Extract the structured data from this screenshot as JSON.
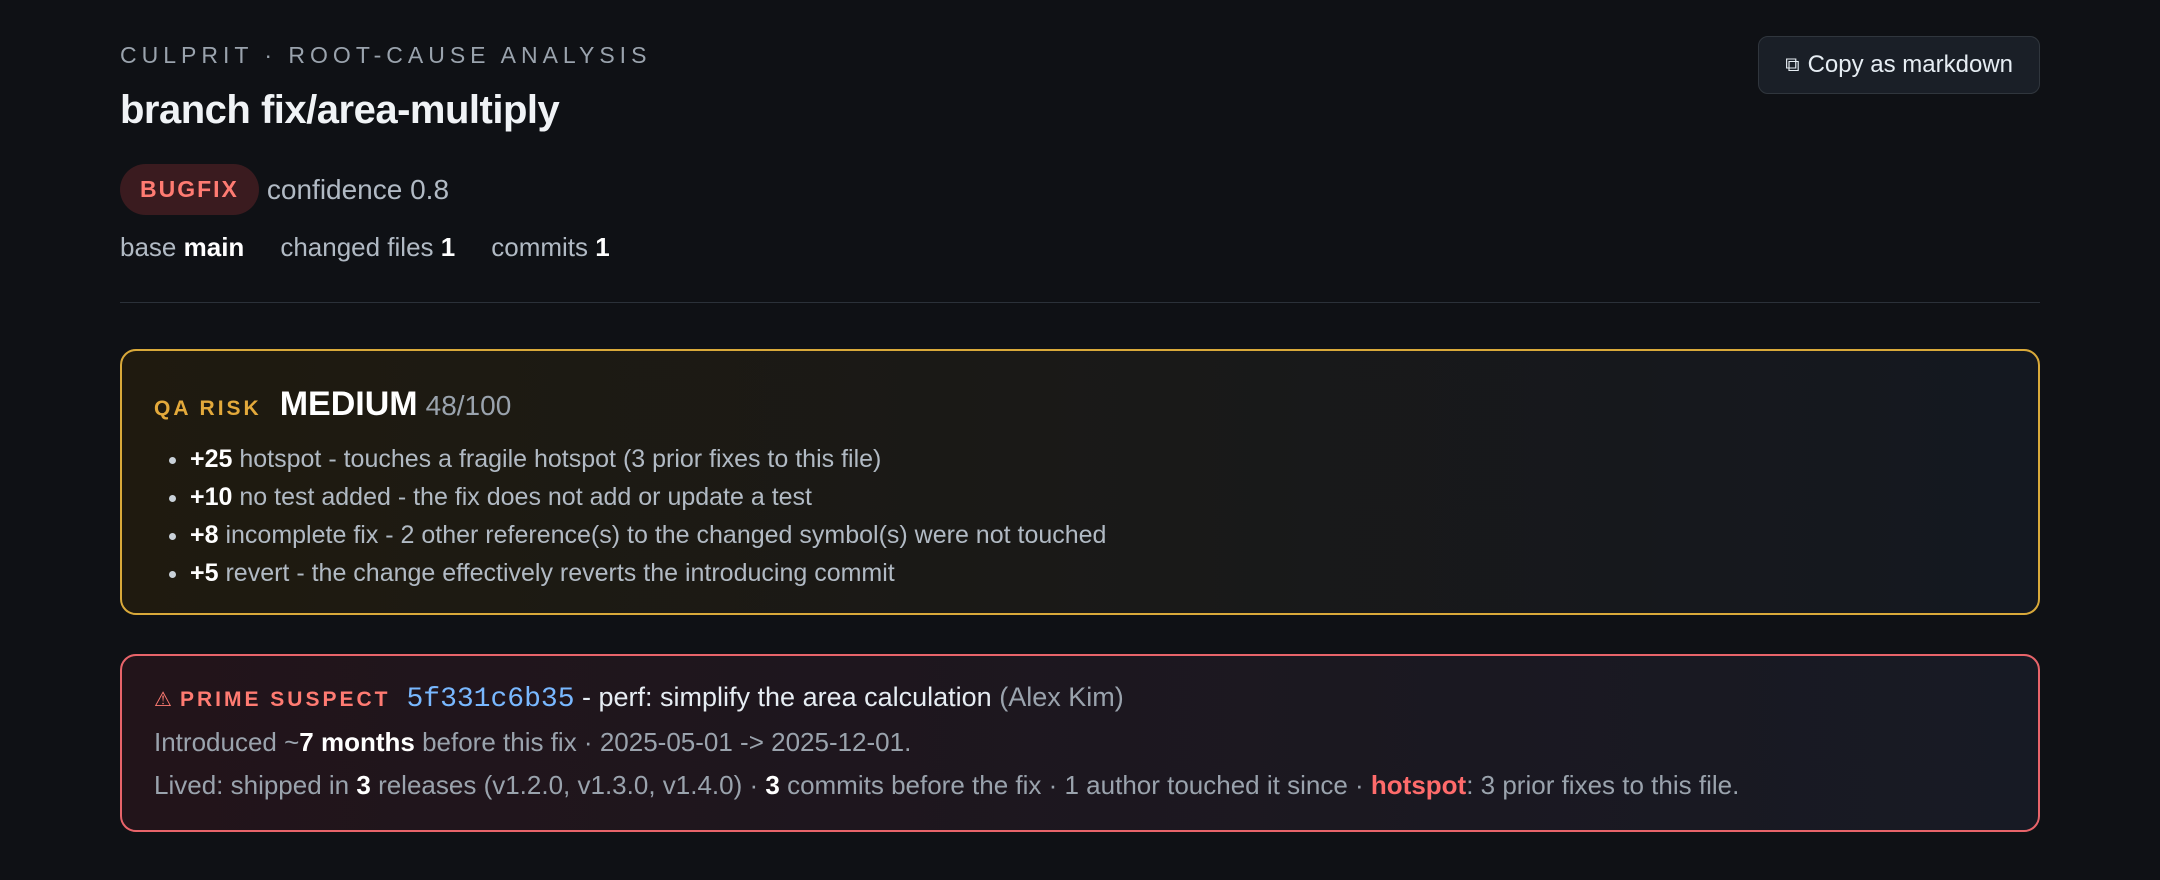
{
  "header": {
    "eyebrow": "CULPRIT · ROOT-CAUSE ANALYSIS",
    "title": "branch fix/area-multiply",
    "copy_label": "Copy as markdown",
    "copy_icon": "copy-icon"
  },
  "classification": {
    "badge": "BUGFIX",
    "confidence": "confidence 0.8",
    "badge_color": "#ff7b72"
  },
  "meta": {
    "base_label": "base",
    "base_value": "main",
    "files_label": "changed files",
    "files_value": "1",
    "commits_label": "commits",
    "commits_value": "1"
  },
  "qa_risk": {
    "label": "QA RISK",
    "level": "MEDIUM",
    "score": "48/100",
    "accent": "#e3a93b",
    "items": [
      {
        "points": "+25",
        "text": "hotspot - touches a fragile hotspot (3 prior fixes to this file)"
      },
      {
        "points": "+10",
        "text": "no test added - the fix does not add or update a test"
      },
      {
        "points": "+8",
        "text": "incomplete fix - 2 other reference(s) to the changed symbol(s) were not touched"
      },
      {
        "points": "+5",
        "text": "revert - the change effectively reverts the introducing commit"
      }
    ]
  },
  "suspect": {
    "icon": "warning-icon",
    "label": "PRIME SUSPECT",
    "sha": "5f331c6b35",
    "separator": " - ",
    "message": "perf: simplify the area calculation",
    "author": "(Alex Kim)",
    "accent": "#e8646a",
    "introduced": {
      "prefix": "Introduced ~",
      "duration": "7 months",
      "suffix": " before this fix · 2025-05-01 -> 2025-12-01."
    },
    "lived": {
      "prefix": "Lived: shipped in ",
      "releases_count": "3",
      "releases_text": " releases (v1.2.0, v1.3.0, v1.4.0) · ",
      "commits_count": "3",
      "commits_text": " commits before the fix · 1 author touched it since · ",
      "hotspot": "hotspot",
      "hotspot_text": ": 3 prior fixes to this file."
    }
  }
}
